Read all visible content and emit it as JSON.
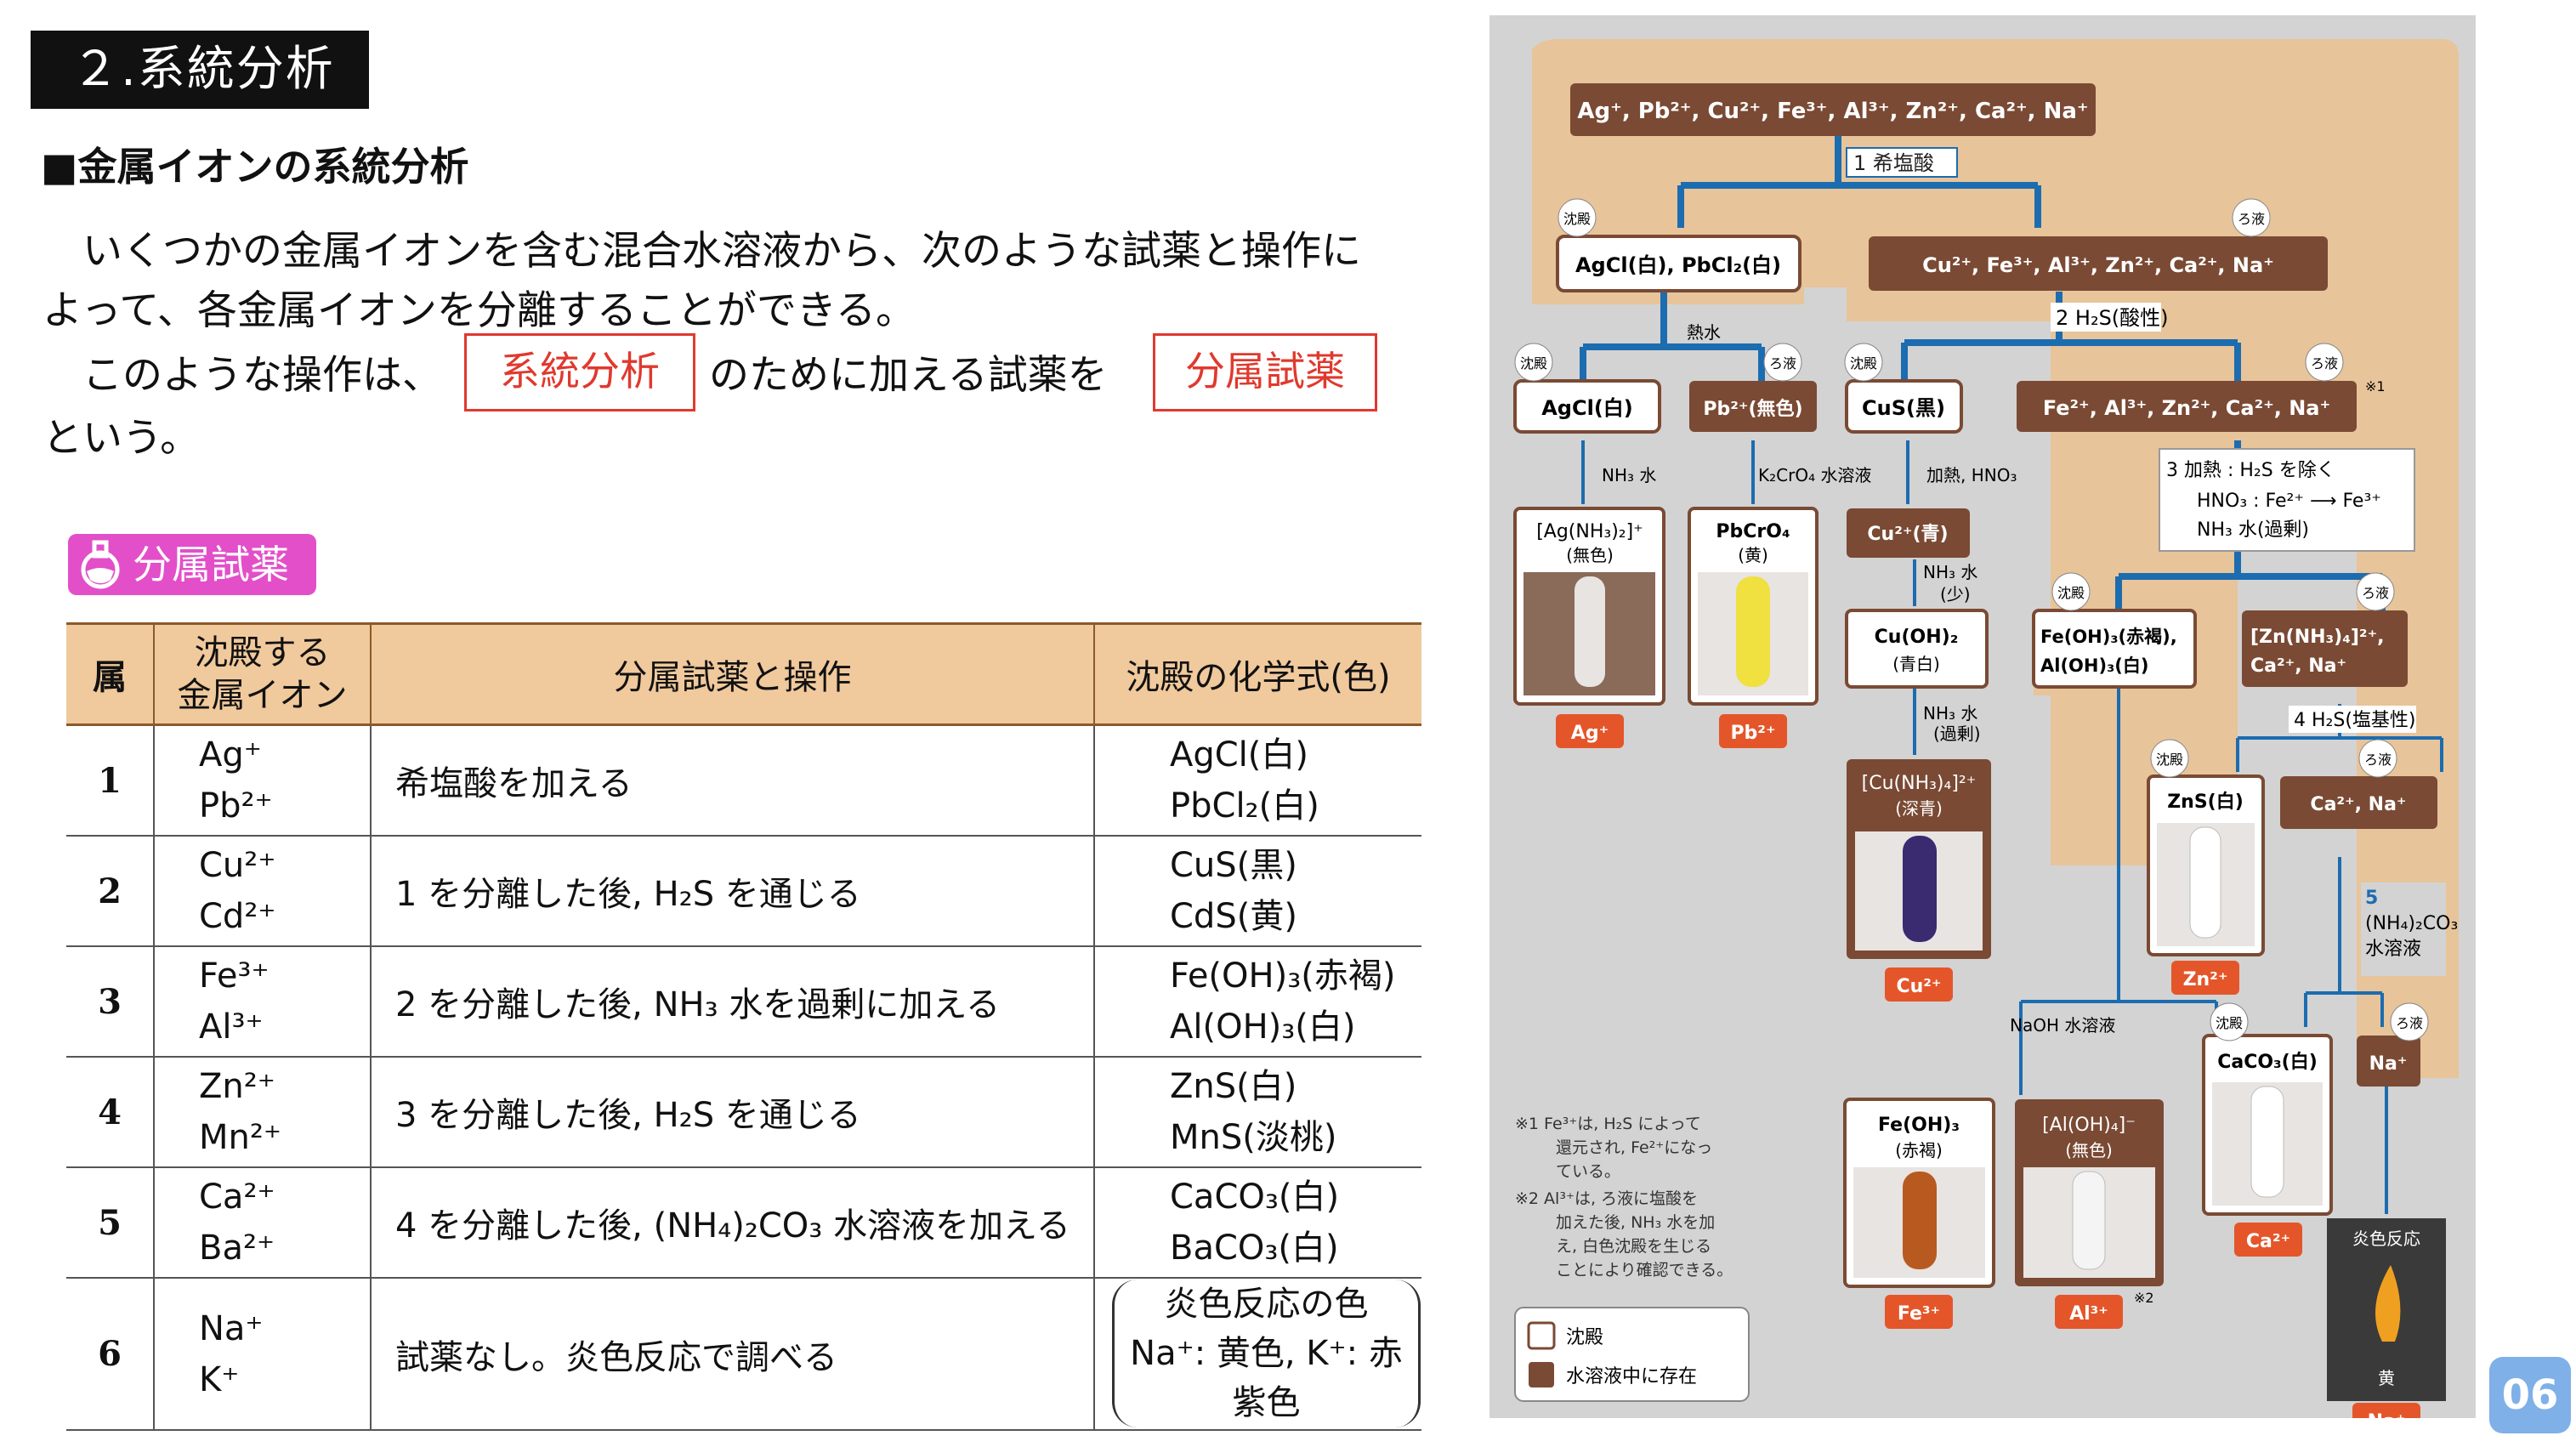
{
  "section_title": "２.系統分析",
  "subheading": "■金属イオンの系統分析",
  "intro": {
    "line1": "　いくつかの金属イオンを含む混合水溶液から、次のような試薬と操作に",
    "line2": "よって、各金属イオンを分離することができる。",
    "line3_a": "　このような操作は、",
    "box1": "系統分析",
    "line3_b": "のために加える試薬を",
    "box2": "分属試薬",
    "line4": "という。"
  },
  "badge": "分属試薬",
  "table": {
    "headers": [
      "属",
      "沈殿する\n金属イオン",
      "分属試薬と操作",
      "沈殿の化学式(色)"
    ],
    "rows": [
      {
        "no": "1",
        "ion1": "Ag⁺",
        "ion2": "Pb²⁺",
        "op": "希塩酸を加える",
        "p1": "AgCl(白)",
        "p2": "PbCl₂(白)"
      },
      {
        "no": "2",
        "ion1": "Cu²⁺",
        "ion2": "Cd²⁺",
        "op": "1 を分離した後, H₂S を通じる",
        "p1": "CuS(黒)",
        "p2": "CdS(黄)"
      },
      {
        "no": "3",
        "ion1": "Fe³⁺",
        "ion2": "Al³⁺",
        "op": "2 を分離した後, NH₃ 水を過剰に加える",
        "p1": "Fe(OH)₃(赤褐)",
        "p2": "Al(OH)₃(白)"
      },
      {
        "no": "4",
        "ion1": "Zn²⁺",
        "ion2": "Mn²⁺",
        "op": "3 を分離した後, H₂S を通じる",
        "p1": "ZnS(白)",
        "p2": "MnS(淡桃)"
      },
      {
        "no": "5",
        "ion1": "Ca²⁺",
        "ion2": "Ba²⁺",
        "op": "4 を分離した後, (NH₄)₂CO₃ 水溶液を加える",
        "p1": "CaCO₃(白)",
        "p2": "BaCO₃(白)"
      },
      {
        "no": "6",
        "ion1": "Na⁺",
        "ion2": "K⁺",
        "op": "試薬なし。炎色反応で調べる",
        "p1": "炎色反応の色",
        "p2": "Na⁺: 黄色, K⁺: 赤紫色"
      }
    ]
  },
  "flow": {
    "top": "Ag⁺, Pb²⁺, Cu²⁺, Fe³⁺, Al³⁺, Zn²⁺, Ca²⁺, Na⁺",
    "step1": "1 希塩酸",
    "ppt_tag": "沈殿",
    "filt_tag": "ろ液",
    "agcl_pbcl2": "AgCl(白), PbCl₂(白)",
    "filtrate1": "Cu²⁺, Fe³⁺, Al³⁺, Zn²⁺, Ca²⁺, Na⁺",
    "hot_water": "熱水",
    "step2": "2 H₂S(酸性)",
    "agcl": "AgCl(白)",
    "pb": "Pb²⁺(無色)",
    "cus": "CuS(黒)",
    "filtrate2": "Fe²⁺, Al³⁺, Zn²⁺, Ca²⁺, Na⁺",
    "note1_mark": "※1",
    "nh3": "NH₃ 水",
    "k2cro4": "K₂CrO₄ 水溶液",
    "heat_hno3": "加熱, HNO₃",
    "step3_l1": "3 加熱 : H₂S を除く",
    "step3_l2": "HNO₃ : Fe²⁺ ⟶ Fe³⁺",
    "step3_l3": "NH₃ 水(過剰)",
    "ag_complex": "[Ag(NH₃)₂]⁺",
    "colorless": "(無色)",
    "pbcro4": "PbCrO₄",
    "yellow": "(黄)",
    "cu_blue": "Cu²⁺(青)",
    "nh3_little": "NH₃ 水",
    "little": "(少)",
    "cuoh2": "Cu(OH)₂",
    "bluewhite": "(青白)",
    "nh3_excess": "NH₃ 水",
    "excess": "(過剰)",
    "cu_complex": "[Cu(NH₃)₄]²⁺",
    "deep_blue": "(深青)",
    "feoh_aloh_1": "Fe(OH)₃(赤褐),",
    "feoh_aloh_2": "Al(OH)₃(白)",
    "zn_complex_1": "[Zn(NH₃)₄]²⁺,",
    "zn_complex_2": "Ca²⁺, Na⁺",
    "step4": "4 H₂S(塩基性)",
    "zns": "ZnS(白)",
    "ca_na": "Ca²⁺, Na⁺",
    "step5_l1": "5",
    "step5_l2": "(NH₄)₂CO₃",
    "step5_l3": "水溶液",
    "naoh": "NaOH 水溶液",
    "caco3": "CaCO₃(白)",
    "na": "Na⁺",
    "feoh3": "Fe(OH)₃",
    "red_brown": "(赤褐)",
    "al_complex": "[Al(OH)₄]⁻",
    "colorless2": "(無色)",
    "flame": "炎色反応",
    "yellow2": "黄",
    "labels": {
      "ag": "Ag⁺",
      "pb": "Pb²⁺",
      "cu": "Cu²⁺",
      "zn": "Zn²⁺",
      "ca": "Ca²⁺",
      "fe": "Fe³⁺",
      "al": "Al³⁺",
      "na": "Na⁺"
    },
    "note2_mark": "※2",
    "note1": [
      "※1 Fe³⁺は, H₂S によって",
      "還元され, Fe²⁺になっ",
      "ている。"
    ],
    "note2": [
      "※2 Al³⁺は, ろ液に塩酸を",
      "加えた後, NH₃ 水を加",
      "え, 白色沈殿を生じる",
      "ことにより確認できる。"
    ],
    "legend_ppt": "沈殿",
    "legend_aq": "水溶液中に存在"
  },
  "page_number": "06"
}
